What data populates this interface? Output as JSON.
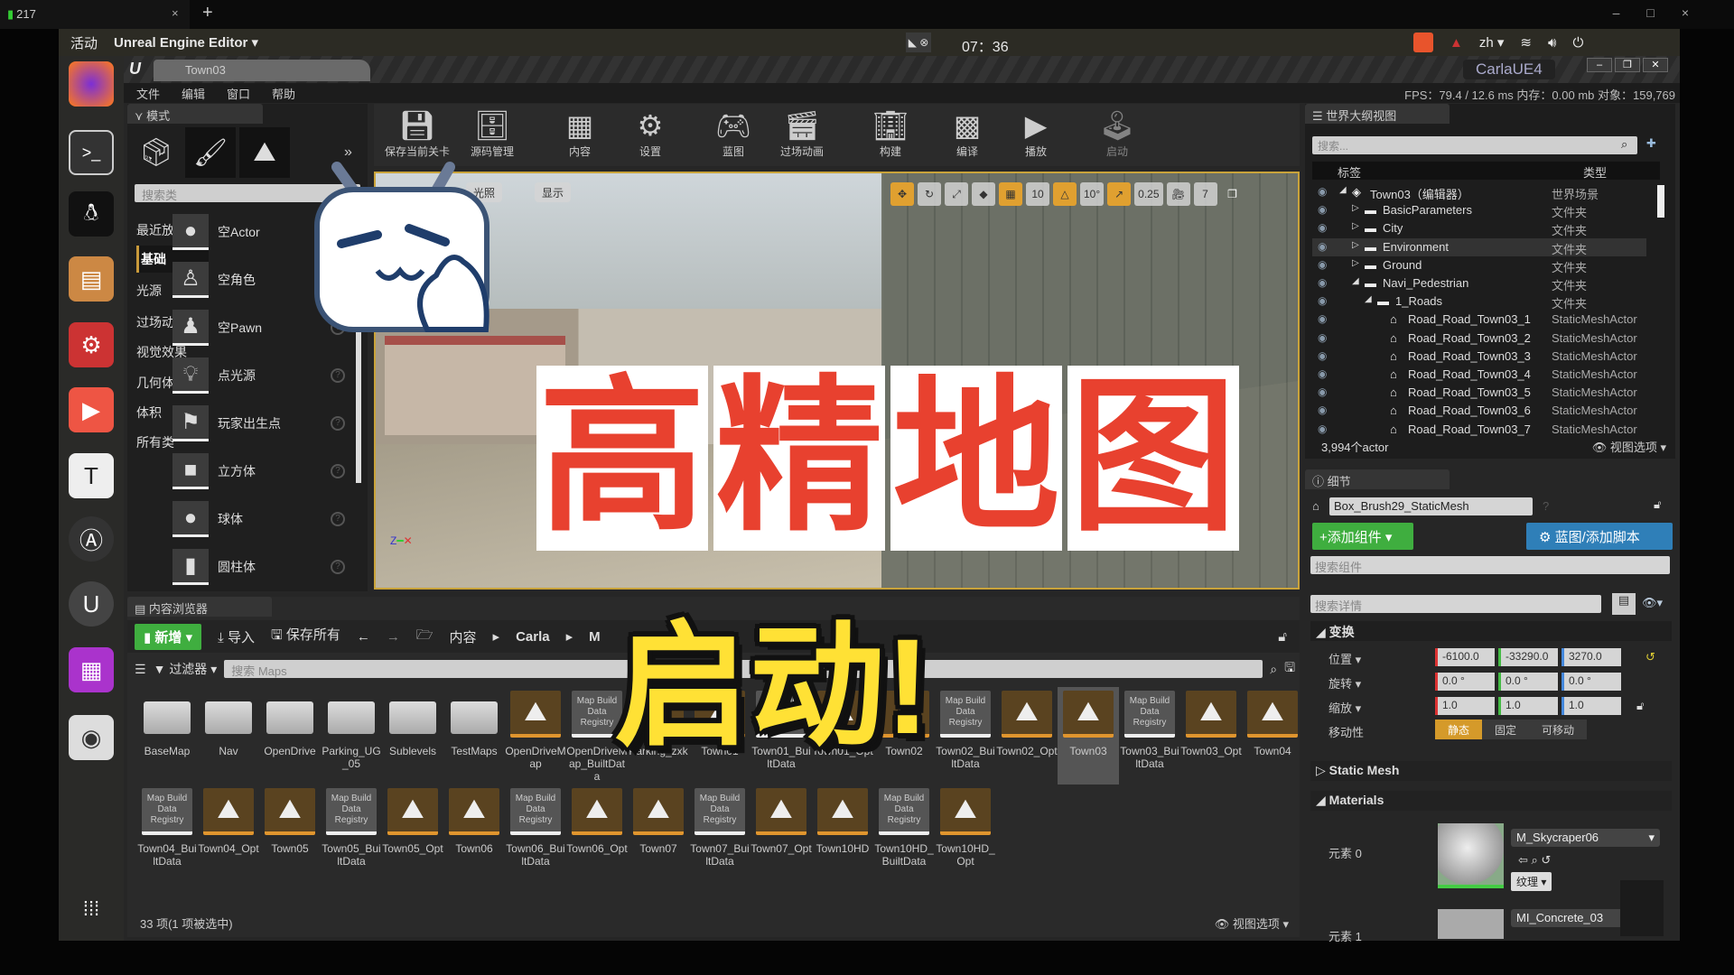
{
  "browser_tab": {
    "signal": "217",
    "close": "×",
    "new": "+"
  },
  "gnome": {
    "activities": "活动",
    "app": "Unreal Engine Editor ▾",
    "clock": "07：36",
    "lang": "zh ▾"
  },
  "window": {
    "tab": "Town03",
    "project": "CarlaUE4",
    "stats": "FPS：79.4  / 12.6 ms  内存：0.00 mb  对象：159,769"
  },
  "menu": [
    "文件",
    "编辑",
    "窗口",
    "帮助"
  ],
  "modes": {
    "title": "模式",
    "search_placeholder": "搜索类",
    "categories": [
      "最近放置",
      "基础",
      "光源",
      "过场动画",
      "视觉效果",
      "几何体",
      "体积",
      "所有类"
    ],
    "selected_category": "基础",
    "items": [
      "空Actor",
      "空角色",
      "空Pawn",
      "点光源",
      "玩家出生点",
      "立方体",
      "球体",
      "圆柱体"
    ]
  },
  "toolbar": [
    "保存当前关卡",
    "源码管理",
    "内容",
    "设置",
    "蓝图",
    "过场动画",
    "构建",
    "编译",
    "播放",
    "启动"
  ],
  "viewport": {
    "lighting": "光照",
    "show": "显示",
    "grid_snap": "10",
    "rotation_snap": "10°",
    "scale_snap": "0.25",
    "camera_speed": "7"
  },
  "overlay": {
    "title": [
      "高",
      "精",
      "地",
      "图"
    ],
    "subtitle": "启动!"
  },
  "content_browser": {
    "title": "内容浏览器",
    "new": "新增 ▾",
    "import": "导入",
    "save_all": "保存所有",
    "breadcrumb": [
      "内容",
      "Carla",
      "M"
    ],
    "filter": "过滤器 ▾",
    "search_placeholder": "搜索 Maps",
    "registry_label": "Map Build Data Registry",
    "assets": [
      {
        "name": "BaseMap",
        "type": "folder"
      },
      {
        "name": "Nav",
        "type": "folder"
      },
      {
        "name": "OpenDrive",
        "type": "folder"
      },
      {
        "name": "Parking_UG_05",
        "type": "folder"
      },
      {
        "name": "Sublevels",
        "type": "folder"
      },
      {
        "name": "TestMaps",
        "type": "folder"
      },
      {
        "name": "OpenDriveMap",
        "type": "map"
      },
      {
        "name": "OpenDriveMap_BuiltData",
        "type": "registry"
      },
      {
        "name": "Parking_zxk",
        "type": "map"
      },
      {
        "name": "Town01",
        "type": "map"
      },
      {
        "name": "Town01_BuiltData",
        "type": "registry"
      },
      {
        "name": "Town01_Opt",
        "type": "map"
      },
      {
        "name": "Town02",
        "type": "map"
      },
      {
        "name": "Town02_BuiltData",
        "type": "registry"
      },
      {
        "name": "Town02_Opt",
        "type": "map"
      },
      {
        "name": "Town03",
        "type": "map",
        "selected": true
      },
      {
        "name": "Town03_BuiltData",
        "type": "registry"
      },
      {
        "name": "Town03_Opt",
        "type": "map"
      },
      {
        "name": "Town04",
        "type": "map"
      },
      {
        "name": "Town04_BuiltData",
        "type": "registry"
      },
      {
        "name": "Town04_Opt",
        "type": "map"
      },
      {
        "name": "Town05",
        "type": "map"
      },
      {
        "name": "Town05_BuiltData",
        "type": "registry"
      },
      {
        "name": "Town05_Opt",
        "type": "map"
      },
      {
        "name": "Town06",
        "type": "map"
      },
      {
        "name": "Town06_BuiltData",
        "type": "registry"
      },
      {
        "name": "Town06_Opt",
        "type": "map"
      },
      {
        "name": "Town07",
        "type": "map"
      },
      {
        "name": "Town07_BuiltData",
        "type": "registry"
      },
      {
        "name": "Town07_Opt",
        "type": "map"
      },
      {
        "name": "Town10HD",
        "type": "map"
      },
      {
        "name": "Town10HD_BuiltData",
        "type": "registry"
      },
      {
        "name": "Town10HD_Opt",
        "type": "map"
      }
    ],
    "status": "33 项(1 项被选中)",
    "view_options": "视图选项 ▾"
  },
  "outliner": {
    "title": "世界大纲视图",
    "search_placeholder": "搜索...",
    "col_label": "标签",
    "col_type": "类型",
    "rows": [
      {
        "label": "Town03（编辑器）",
        "type": "世界场景",
        "depth": 0,
        "icon": "world"
      },
      {
        "label": "BasicParameters",
        "type": "文件夹",
        "depth": 1,
        "icon": "folder"
      },
      {
        "label": "City",
        "type": "文件夹",
        "depth": 1,
        "icon": "folder"
      },
      {
        "label": "Environment",
        "type": "文件夹",
        "depth": 1,
        "icon": "folder",
        "hover": true
      },
      {
        "label": "Ground",
        "type": "文件夹",
        "depth": 1,
        "icon": "folder"
      },
      {
        "label": "Navi_Pedestrian",
        "type": "文件夹",
        "depth": 1,
        "icon": "folder",
        "open": true
      },
      {
        "label": "1_Roads",
        "type": "文件夹",
        "depth": 2,
        "icon": "folder",
        "open": true
      },
      {
        "label": "Road_Road_Town03_1",
        "type": "StaticMeshActor",
        "depth": 3,
        "icon": "actor"
      },
      {
        "label": "Road_Road_Town03_2",
        "type": "StaticMeshActor",
        "depth": 3,
        "icon": "actor"
      },
      {
        "label": "Road_Road_Town03_3",
        "type": "StaticMeshActor",
        "depth": 3,
        "icon": "actor"
      },
      {
        "label": "Road_Road_Town03_4",
        "type": "StaticMeshActor",
        "depth": 3,
        "icon": "actor"
      },
      {
        "label": "Road_Road_Town03_5",
        "type": "StaticMeshActor",
        "depth": 3,
        "icon": "actor"
      },
      {
        "label": "Road_Road_Town03_6",
        "type": "StaticMeshActor",
        "depth": 3,
        "icon": "actor"
      },
      {
        "label": "Road_Road_Town03_7",
        "type": "StaticMeshActor",
        "depth": 3,
        "icon": "actor"
      }
    ],
    "count": "3,994个actor",
    "view_options": "视图选项 ▾"
  },
  "details": {
    "title": "细节",
    "actor_name": "Box_Brush29_StaticMesh",
    "add_component": "+添加组件 ▾",
    "blueprint": "蓝图/添加脚本",
    "search_components": "搜索组件",
    "search_details": "搜索详情",
    "transform": "变换",
    "location_label": "位置 ▾",
    "location": [
      "-6100.0",
      "-33290.0",
      "3270.0"
    ],
    "rotation_label": "旋转 ▾",
    "rotation": [
      "0.0 °",
      "0.0 °",
      "0.0 °"
    ],
    "scale_label": "缩放 ▾",
    "scale": [
      "1.0",
      "1.0",
      "1.0"
    ],
    "mobility_label": "移动性",
    "mobility": [
      "静态",
      "固定",
      "可移动"
    ],
    "mobility_selected": "静态",
    "static_mesh": "Static Mesh",
    "materials": "Materials",
    "element0": "元素 0",
    "material0": "M_Skycraper06",
    "texture_btn": "纹理 ▾",
    "element1": "元素 1",
    "material1": "MI_Concrete_03"
  },
  "colors": {
    "accent_green": "#3fae3f",
    "accent_blue": "#2f7fb8",
    "overlay_red": "#e8412f",
    "overlay_yellow": "#ffe135",
    "selection_orange": "#d59a2a"
  }
}
